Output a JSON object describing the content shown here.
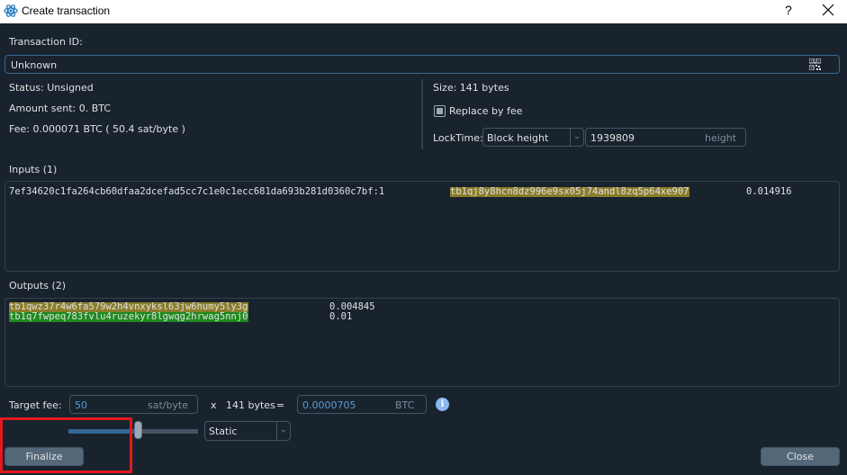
{
  "window": {
    "title": "Create transaction",
    "help_label": "?",
    "app_icon": "electrum-atom-icon",
    "close_icon": "close-icon"
  },
  "transaction_id": {
    "label": "Transaction ID:",
    "value": "Unknown",
    "qr_icon": "qr-code-icon"
  },
  "info": {
    "status": "Status: Unsigned",
    "amount_sent": "Amount sent: 0. BTC",
    "fee": "Fee: 0.000071 BTC  ( 50.4 sat/byte )",
    "size": "Size: 141 bytes",
    "replace_by_fee": {
      "label": "Replace by fee",
      "checked": "partial"
    },
    "locktime": {
      "label": "LockTime:",
      "type_selected": "Block height",
      "value": "1939809",
      "unit": "height"
    }
  },
  "inputs": {
    "label": "Inputs (1)",
    "rows": [
      {
        "outpoint": "7ef34620c1fa264cb60dfaa2dcefad5cc7c1e0c1ecc681da693b281d0360c7bf:1",
        "address": "tb1qj8y8hcn8dz996e9sx05j74andl8zq5p64xe907",
        "amount": "0.014916",
        "highlight": "#8b7d2a"
      }
    ]
  },
  "outputs": {
    "label": "Outputs (2)",
    "rows": [
      {
        "address": "tb1qwz37r4w6fa579w2h4vnxyksl63jw6humy5ly3g",
        "amount": "0.004845",
        "highlight": "#8b7d2a"
      },
      {
        "address": "tb1q7fwpeq783fvlu4ruzekyr8lgwqg2hrwag5nnj0",
        "amount": "0.01",
        "highlight": "#1f8a1f"
      }
    ]
  },
  "fee_controls": {
    "target_fee_label": "Target fee:",
    "target_fee_value": "50",
    "target_fee_unit": "sat/byte",
    "multiply_label": "x",
    "size_label": "141 bytes",
    "equals_label": "=",
    "total_value": "0.0000705",
    "total_unit": "BTC",
    "info_icon": "info-icon",
    "slider_position_fraction": 0.54,
    "mode_selected": "Static"
  },
  "buttons": {
    "finalize": "Finalize",
    "close": "Close"
  },
  "colors": {
    "background": "#19232d",
    "accent": "#346792",
    "highlight_olive": "#8b7d2a",
    "highlight_green": "#1f8a1f",
    "annotation_red": "#e3191f"
  }
}
